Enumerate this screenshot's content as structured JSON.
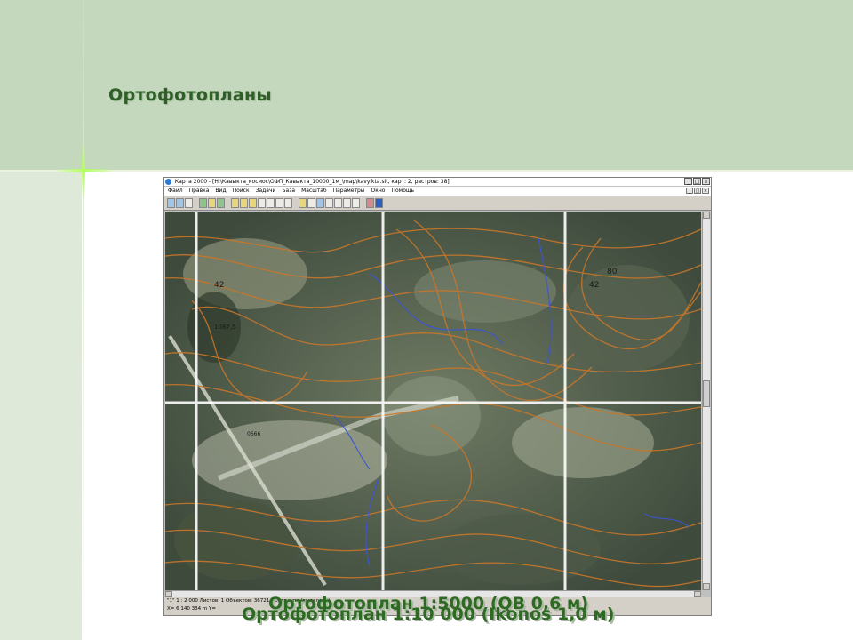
{
  "slide": {
    "title": "Ортофотопланы",
    "caption_1": "Ортофотоплан 1:5000 (QB 0,6 м)",
    "caption_2": "Ортофотоплан 1:10 000 (Ikonos 1,0 м)"
  },
  "window": {
    "title": "Карта 2000 - [H:\\Кавыкта_космос\\ОФП_Кавыкта_10000_1м_\\map\\kavyikta.sit, карт: 2, растров: 38]",
    "buttons": [
      "_",
      "□",
      "×"
    ]
  },
  "menu": [
    "Файл",
    "Правка",
    "Вид",
    "Поиск",
    "Задачи",
    "База",
    "Масштаб",
    "Параметры",
    "Окно",
    "Помощь"
  ],
  "map": {
    "labels": [
      "42",
      "80",
      "42",
      "1087,5",
      "0666"
    ]
  },
  "statusbar": {
    "line1": "\"1\"   1 : 2 000  Листов: 1   Объектов: 36721 / Оттранпо (выделено)",
    "line2": "X= 6 140 334 m   Y="
  },
  "colors": {
    "slide_band": "#c4d8bd",
    "caption_text": "#2f6a24",
    "contour": "#c8772a",
    "hydro": "#3a55d8",
    "grid_line": "#ffffff"
  }
}
